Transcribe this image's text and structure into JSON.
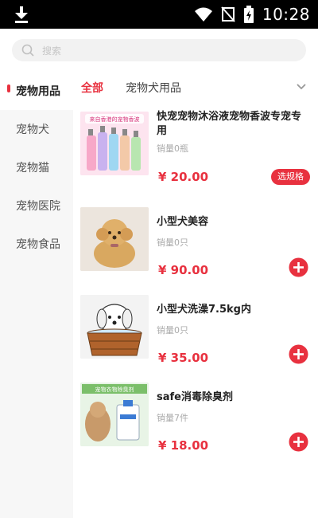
{
  "status_bar": {
    "time": "10:28"
  },
  "search": {
    "placeholder": "搜索"
  },
  "sidebar": {
    "items": [
      {
        "label": "宠物用品",
        "active": true
      },
      {
        "label": "宠物犬",
        "active": false
      },
      {
        "label": "宠物猫",
        "active": false
      },
      {
        "label": "宠物医院",
        "active": false
      },
      {
        "label": "宠物食品",
        "active": false
      }
    ]
  },
  "tabs": [
    {
      "label": "全部",
      "active": true
    },
    {
      "label": "宠物犬用品",
      "active": false
    }
  ],
  "products": [
    {
      "name": "快宠宠物沐浴液宠物香波专宠专用",
      "sales": "销量0瓶",
      "price": "¥ 20.00",
      "action": "选规格",
      "thumb_text": "来自香港的宠物香波"
    },
    {
      "name": "小型犬美容",
      "sales": "销量0只",
      "price": "¥ 90.00",
      "action": "add"
    },
    {
      "name": "小型犬洗澡7.5kg内",
      "sales": "销量0只",
      "price": "¥ 35.00",
      "action": "add"
    },
    {
      "name": "safe消毒除臭剂",
      "sales": "销量7件",
      "price": "¥ 18.00",
      "action": "add",
      "thumb_text": "宠物衣物除臭剂"
    }
  ],
  "colors": {
    "accent": "#e8313f",
    "sidebar_bg": "#f7f7f7",
    "search_bg": "#f2f2f2"
  }
}
